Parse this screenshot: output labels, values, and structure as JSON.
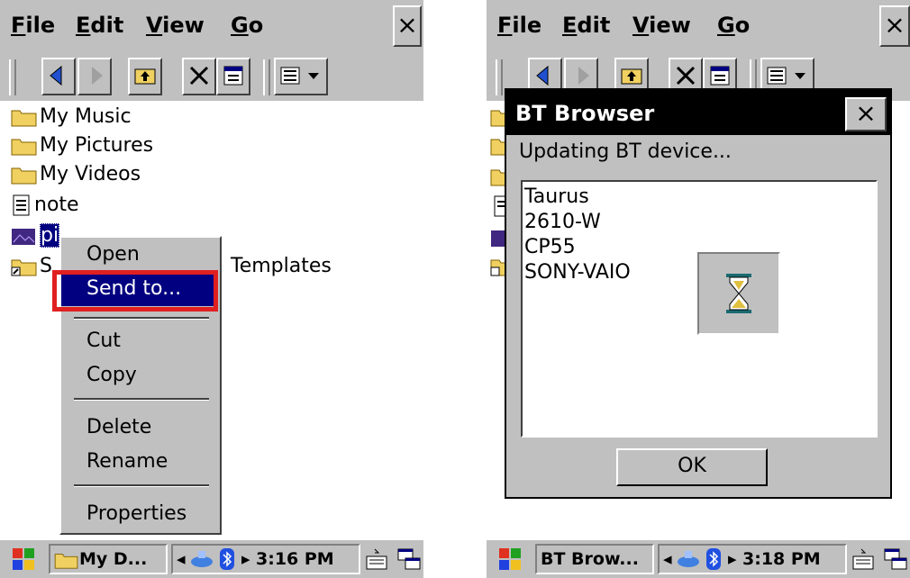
{
  "left": {
    "menu": {
      "file": "File",
      "file_ul": "F",
      "file_rest": "ile",
      "edit": "Edit",
      "edit_ul": "E",
      "edit_rest": "dit",
      "view": "View",
      "view_ul": "V",
      "view_rest": "iew",
      "go": "Go",
      "go_ul": "G",
      "go_rest": "o",
      "close": "×"
    },
    "files": [
      "My Music",
      "My Pictures",
      "My Videos",
      "note",
      "pic",
      "Templates"
    ],
    "files_partial": {
      "pic_prefix": "pi",
      "templates_prefix": "S"
    },
    "context_menu": {
      "open": "Open",
      "send_to": "Send to...",
      "cut": "Cut",
      "copy": "Copy",
      "delete": "Delete",
      "rename": "Rename",
      "properties": "Properties"
    },
    "taskbar": {
      "app": "My D...",
      "time": "3:16 PM"
    }
  },
  "right": {
    "menu": {
      "file_ul": "F",
      "file_rest": "ile",
      "edit_ul": "E",
      "edit_rest": "dit",
      "view_ul": "V",
      "view_rest": "iew",
      "go_ul": "G",
      "go_rest": "o",
      "close": "×"
    },
    "dialog": {
      "title": "BT Browser",
      "close": "×",
      "status": "Updating BT device...",
      "devices": [
        "Taurus",
        "2610-W",
        "CP55",
        "SONY-VAIO"
      ],
      "ok": "OK"
    },
    "taskbar": {
      "app": "BT Brow...",
      "time": "3:18 PM"
    }
  },
  "colors": {
    "selection": "#000080",
    "highlight_box": "#e02020",
    "chrome": "#c0c0c0"
  }
}
